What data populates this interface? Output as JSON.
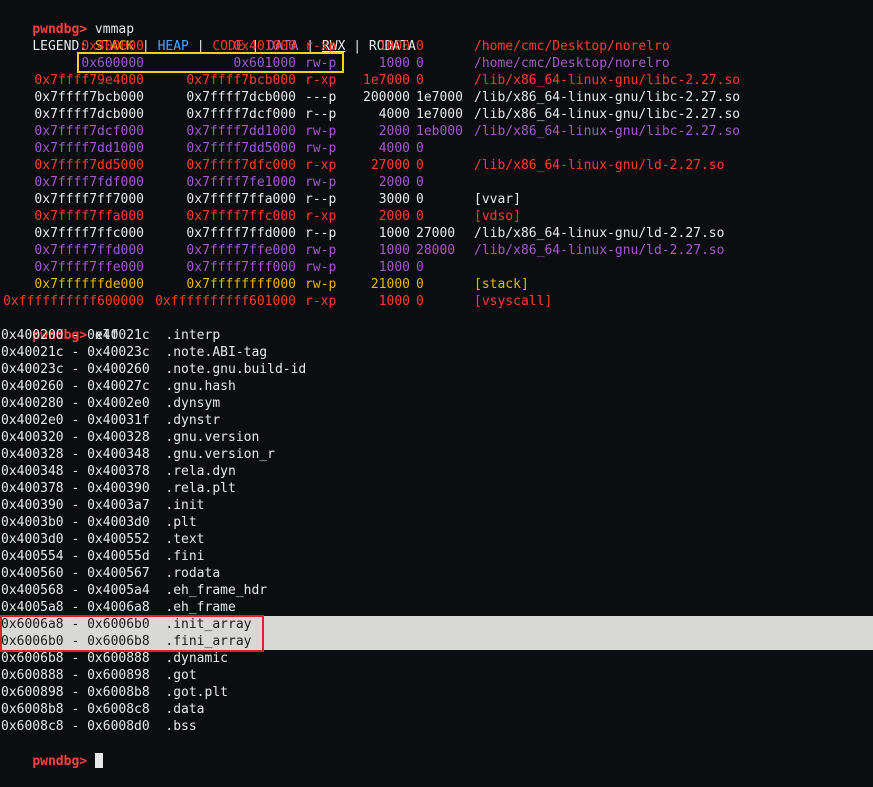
{
  "prompt1": "pwndbg>",
  "cmd1": " vmmap",
  "legend": {
    "label": "LEGEND: ",
    "stack": "STACK",
    "heap": "HEAP",
    "code": "CODE",
    "data": "DATA",
    "rwx": "RWX",
    "rodata": "RODATA",
    "sep": " | "
  },
  "vmmap_rows": [
    {
      "start": "0x400000",
      "end": "0x401000",
      "perm": "r-xp",
      "size": "1000",
      "offset": "0",
      "path": "/home/cmc/Desktop/norelro",
      "kind": "code"
    },
    {
      "start": "0x600000",
      "end": "0x601000",
      "perm": "rw-p",
      "size": "1000",
      "offset": "0",
      "path": "/home/cmc/Desktop/norelro",
      "kind": "data"
    },
    {
      "start": "0x7ffff79e4000",
      "end": "0x7ffff7bcb000",
      "perm": "r-xp",
      "size": "1e7000",
      "offset": "0",
      "path": "/lib/x86_64-linux-gnu/libc-2.27.so",
      "kind": "code"
    },
    {
      "start": "0x7ffff7bcb000",
      "end": "0x7ffff7dcb000",
      "perm": "---p",
      "size": "200000",
      "offset": "1e7000",
      "path": "/lib/x86_64-linux-gnu/libc-2.27.so",
      "kind": "ro"
    },
    {
      "start": "0x7ffff7dcb000",
      "end": "0x7ffff7dcf000",
      "perm": "r--p",
      "size": "4000",
      "offset": "1e7000",
      "path": "/lib/x86_64-linux-gnu/libc-2.27.so",
      "kind": "ro"
    },
    {
      "start": "0x7ffff7dcf000",
      "end": "0x7ffff7dd1000",
      "perm": "rw-p",
      "size": "2000",
      "offset": "1eb000",
      "path": "/lib/x86_64-linux-gnu/libc-2.27.so",
      "kind": "data"
    },
    {
      "start": "0x7ffff7dd1000",
      "end": "0x7ffff7dd5000",
      "perm": "rw-p",
      "size": "4000",
      "offset": "0",
      "path": "",
      "kind": "data"
    },
    {
      "start": "0x7ffff7dd5000",
      "end": "0x7ffff7dfc000",
      "perm": "r-xp",
      "size": "27000",
      "offset": "0",
      "path": "/lib/x86_64-linux-gnu/ld-2.27.so",
      "kind": "code"
    },
    {
      "start": "0x7ffff7fdf000",
      "end": "0x7ffff7fe1000",
      "perm": "rw-p",
      "size": "2000",
      "offset": "0",
      "path": "",
      "kind": "data"
    },
    {
      "start": "0x7ffff7ff7000",
      "end": "0x7ffff7ffa000",
      "perm": "r--p",
      "size": "3000",
      "offset": "0",
      "path": "[vvar]",
      "kind": "ro"
    },
    {
      "start": "0x7ffff7ffa000",
      "end": "0x7ffff7ffc000",
      "perm": "r-xp",
      "size": "2000",
      "offset": "0",
      "path": "[vdso]",
      "kind": "code"
    },
    {
      "start": "0x7ffff7ffc000",
      "end": "0x7ffff7ffd000",
      "perm": "r--p",
      "size": "1000",
      "offset": "27000",
      "path": "/lib/x86_64-linux-gnu/ld-2.27.so",
      "kind": "ro"
    },
    {
      "start": "0x7ffff7ffd000",
      "end": "0x7ffff7ffe000",
      "perm": "rw-p",
      "size": "1000",
      "offset": "28000",
      "path": "/lib/x86_64-linux-gnu/ld-2.27.so",
      "kind": "data"
    },
    {
      "start": "0x7ffff7ffe000",
      "end": "0x7ffff7fff000",
      "perm": "rw-p",
      "size": "1000",
      "offset": "0",
      "path": "",
      "kind": "data"
    },
    {
      "start": "0x7ffffffde000",
      "end": "0x7ffffffff000",
      "perm": "rw-p",
      "size": "21000",
      "offset": "0",
      "path": "[stack]",
      "kind": "stack"
    },
    {
      "start": "0xffffffffff600000",
      "end": "0xffffffffff601000",
      "perm": "r-xp",
      "size": "1000",
      "offset": "0",
      "path": "[vsyscall]",
      "kind": "code"
    }
  ],
  "prompt2": "pwndbg>",
  "cmd2": " elf",
  "elf_rows": [
    {
      "range": "0x400200 - 0x40021c",
      "name": ".interp"
    },
    {
      "range": "0x40021c - 0x40023c",
      "name": ".note.ABI-tag"
    },
    {
      "range": "0x40023c - 0x400260",
      "name": ".note.gnu.build-id"
    },
    {
      "range": "0x400260 - 0x40027c",
      "name": ".gnu.hash"
    },
    {
      "range": "0x400280 - 0x4002e0",
      "name": ".dynsym"
    },
    {
      "range": "0x4002e0 - 0x40031f",
      "name": ".dynstr"
    },
    {
      "range": "0x400320 - 0x400328",
      "name": ".gnu.version"
    },
    {
      "range": "0x400328 - 0x400348",
      "name": ".gnu.version_r"
    },
    {
      "range": "0x400348 - 0x400378",
      "name": ".rela.dyn"
    },
    {
      "range": "0x400378 - 0x400390",
      "name": ".rela.plt"
    },
    {
      "range": "0x400390 - 0x4003a7",
      "name": ".init"
    },
    {
      "range": "0x4003b0 - 0x4003d0",
      "name": ".plt"
    },
    {
      "range": "0x4003d0 - 0x400552",
      "name": ".text"
    },
    {
      "range": "0x400554 - 0x40055d",
      "name": ".fini"
    },
    {
      "range": "0x400560 - 0x400567",
      "name": ".rodata"
    },
    {
      "range": "0x400568 - 0x4005a4",
      "name": ".eh_frame_hdr"
    },
    {
      "range": "0x4005a8 - 0x4006a8",
      "name": ".eh_frame"
    },
    {
      "range": "0x6006a8 - 0x6006b0",
      "name": ".init_array",
      "selected": true
    },
    {
      "range": "0x6006b0 - 0x6006b8",
      "name": ".fini_array",
      "selected": true
    },
    {
      "range": "0x6006b8 - 0x600888",
      "name": ".dynamic"
    },
    {
      "range": "0x600888 - 0x600898",
      "name": ".got"
    },
    {
      "range": "0x600898 - 0x6008b8",
      "name": ".got.plt"
    },
    {
      "range": "0x6008b8 - 0x6008c8",
      "name": ".data"
    },
    {
      "range": "0x6008c8 - 0x6008d0",
      "name": ".bss"
    }
  ],
  "prompt3": "pwndbg>",
  "colors": {
    "prompt": "#ff4040",
    "code": "#ff3b30",
    "data": "#a259c9",
    "stack": "#e6b800",
    "heap": "#4aa3ff",
    "highlight_yellow": "#f2d21b",
    "highlight_red": "#e0202a",
    "selection": "#d8d9d4"
  }
}
